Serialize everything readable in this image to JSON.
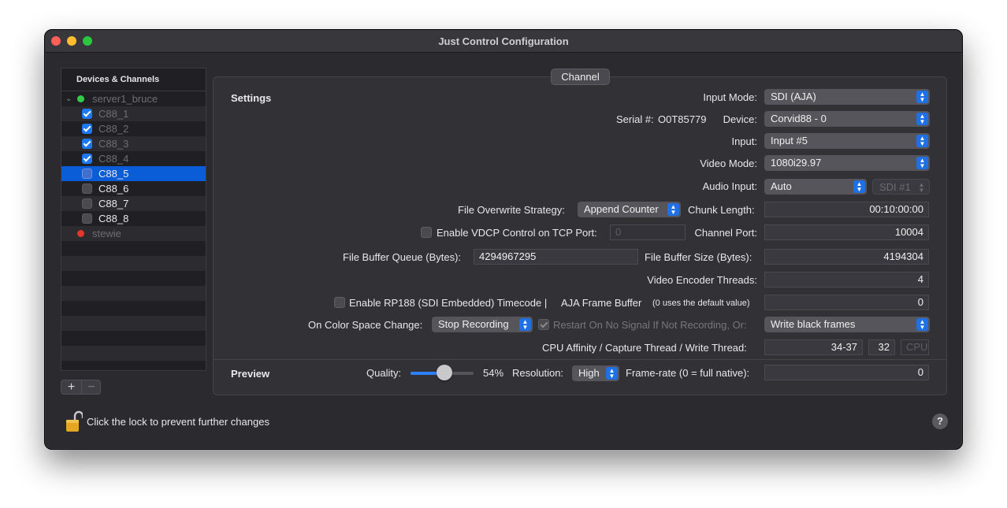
{
  "window": {
    "title": "Just Control Configuration"
  },
  "sidebar": {
    "header": "Devices & Channels",
    "items": [
      {
        "label": "server1_bruce",
        "kind": "server",
        "status": "green",
        "expanded": true
      },
      {
        "label": "C88_1",
        "kind": "channel",
        "checked": true
      },
      {
        "label": "C88_2",
        "kind": "channel",
        "checked": true
      },
      {
        "label": "C88_3",
        "kind": "channel",
        "checked": true
      },
      {
        "label": "C88_4",
        "kind": "channel",
        "checked": true
      },
      {
        "label": "C88_5",
        "kind": "channel",
        "checked": false,
        "selected": true
      },
      {
        "label": "C88_6",
        "kind": "channel",
        "checked": false
      },
      {
        "label": "C88_7",
        "kind": "channel",
        "checked": false
      },
      {
        "label": "C88_8",
        "kind": "channel",
        "checked": false
      },
      {
        "label": "stewie",
        "kind": "server",
        "status": "red"
      }
    ],
    "add_label": "+",
    "remove_label": "−"
  },
  "tab": {
    "label": "Channel"
  },
  "settings": {
    "title": "Settings",
    "input_mode": {
      "label": "Input Mode:",
      "value": "SDI (AJA)"
    },
    "serial": {
      "label": "Serial #:",
      "value": "O0T85779"
    },
    "device": {
      "label": "Device:",
      "value": "Corvid88 - 0"
    },
    "input": {
      "label": "Input:",
      "value": "Input #5"
    },
    "video_mode": {
      "label": "Video Mode:",
      "value": "1080i29.97"
    },
    "audio_input": {
      "label": "Audio Input:",
      "value": "Auto",
      "secondary": "SDI #1"
    },
    "file_overwrite": {
      "label": "File Overwrite Strategy:",
      "value": "Append Counter"
    },
    "chunk_length": {
      "label": "Chunk Length:",
      "value": "00:10:00:00"
    },
    "vdcp": {
      "label": "Enable VDCP Control on TCP Port:",
      "checked": false,
      "port": "0"
    },
    "channel_port": {
      "label": "Channel Port:",
      "value": "10004"
    },
    "file_buffer_queue": {
      "label": "File Buffer Queue (Bytes):",
      "value": "4294967295"
    },
    "file_buffer_size": {
      "label": "File Buffer Size (Bytes):",
      "value": "4194304"
    },
    "video_encoder_threads": {
      "label": "Video Encoder Threads:",
      "value": "4"
    },
    "rp188": {
      "label": "Enable RP188 (SDI Embedded) Timecode |",
      "checked": false
    },
    "aja_frame_buffer": {
      "label": "AJA Frame Buffer",
      "note": "(0 uses the default value)",
      "value": "0"
    },
    "color_space": {
      "label": "On Color Space Change:",
      "value": "Stop Recording"
    },
    "restart_no_signal": {
      "label": "Restart On No Signal If Not Recording, Or:",
      "checked": true,
      "value": "Write black frames"
    },
    "cpu_affinity": {
      "label": "CPU Affinity / Capture Thread / Write Thread:",
      "capture": "34-37",
      "write": "32",
      "placeholder": "CPU"
    }
  },
  "preview": {
    "title": "Preview",
    "quality": {
      "label": "Quality:",
      "value": "54%",
      "fraction": 0.54
    },
    "resolution": {
      "label": "Resolution:",
      "value": "High"
    },
    "frame_rate": {
      "label": "Frame-rate (0 = full native):",
      "value": "0"
    }
  },
  "footer": {
    "lock_text": "Click the lock to prevent further changes",
    "help": "?"
  },
  "colors": {
    "accent": "#1f6fe5",
    "selection": "#0b5dd7",
    "status_green": "#35c84a",
    "status_red": "#e0382c"
  }
}
